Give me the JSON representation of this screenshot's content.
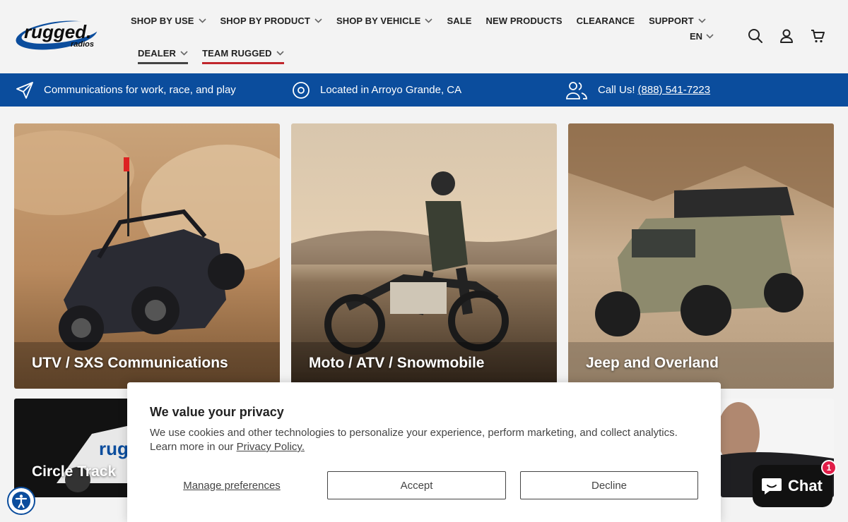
{
  "brand": {
    "logo_text": "rugged.",
    "logo_subtext": "radios"
  },
  "nav": {
    "row1": [
      {
        "label": "SHOP BY USE",
        "dropdown": true
      },
      {
        "label": "SHOP BY PRODUCT",
        "dropdown": true
      },
      {
        "label": "SHOP BY VEHICLE",
        "dropdown": true
      },
      {
        "label": "SALE",
        "dropdown": false
      },
      {
        "label": "NEW PRODUCTS",
        "dropdown": false
      },
      {
        "label": "CLEARANCE",
        "dropdown": false
      },
      {
        "label": "SUPPORT",
        "dropdown": true
      }
    ],
    "row2": [
      {
        "label": "DEALER",
        "dropdown": true
      },
      {
        "label": "TEAM RUGGED",
        "dropdown": true
      }
    ]
  },
  "header_tools": {
    "language": "EN",
    "icons": [
      "search-icon",
      "account-icon",
      "cart-icon"
    ]
  },
  "infobar": {
    "tagline": "Communications for work, race, and play",
    "location": "Located in Arroyo Grande, CA",
    "call_label": "Call Us!",
    "phone": "(888) 541-7223"
  },
  "tiles": [
    {
      "label": "UTV / SXS Communications"
    },
    {
      "label": "Moto / ATV / Snowmobile"
    },
    {
      "label": "Jeep and Overland"
    },
    {
      "label": "Circle Track"
    }
  ],
  "cookie": {
    "title": "We value your privacy",
    "body": "We use cookies and other technologies to personalize your experience, perform marketing, and collect analytics. Learn more in our",
    "policy_link": "Privacy Policy.",
    "manage": "Manage preferences",
    "accept": "Accept",
    "decline": "Decline"
  },
  "chat": {
    "label": "Chat",
    "badge": "1"
  },
  "colors": {
    "brand_blue": "#0b4d9d",
    "accent_red": "#c0262c",
    "badge_red": "#e11d48"
  }
}
